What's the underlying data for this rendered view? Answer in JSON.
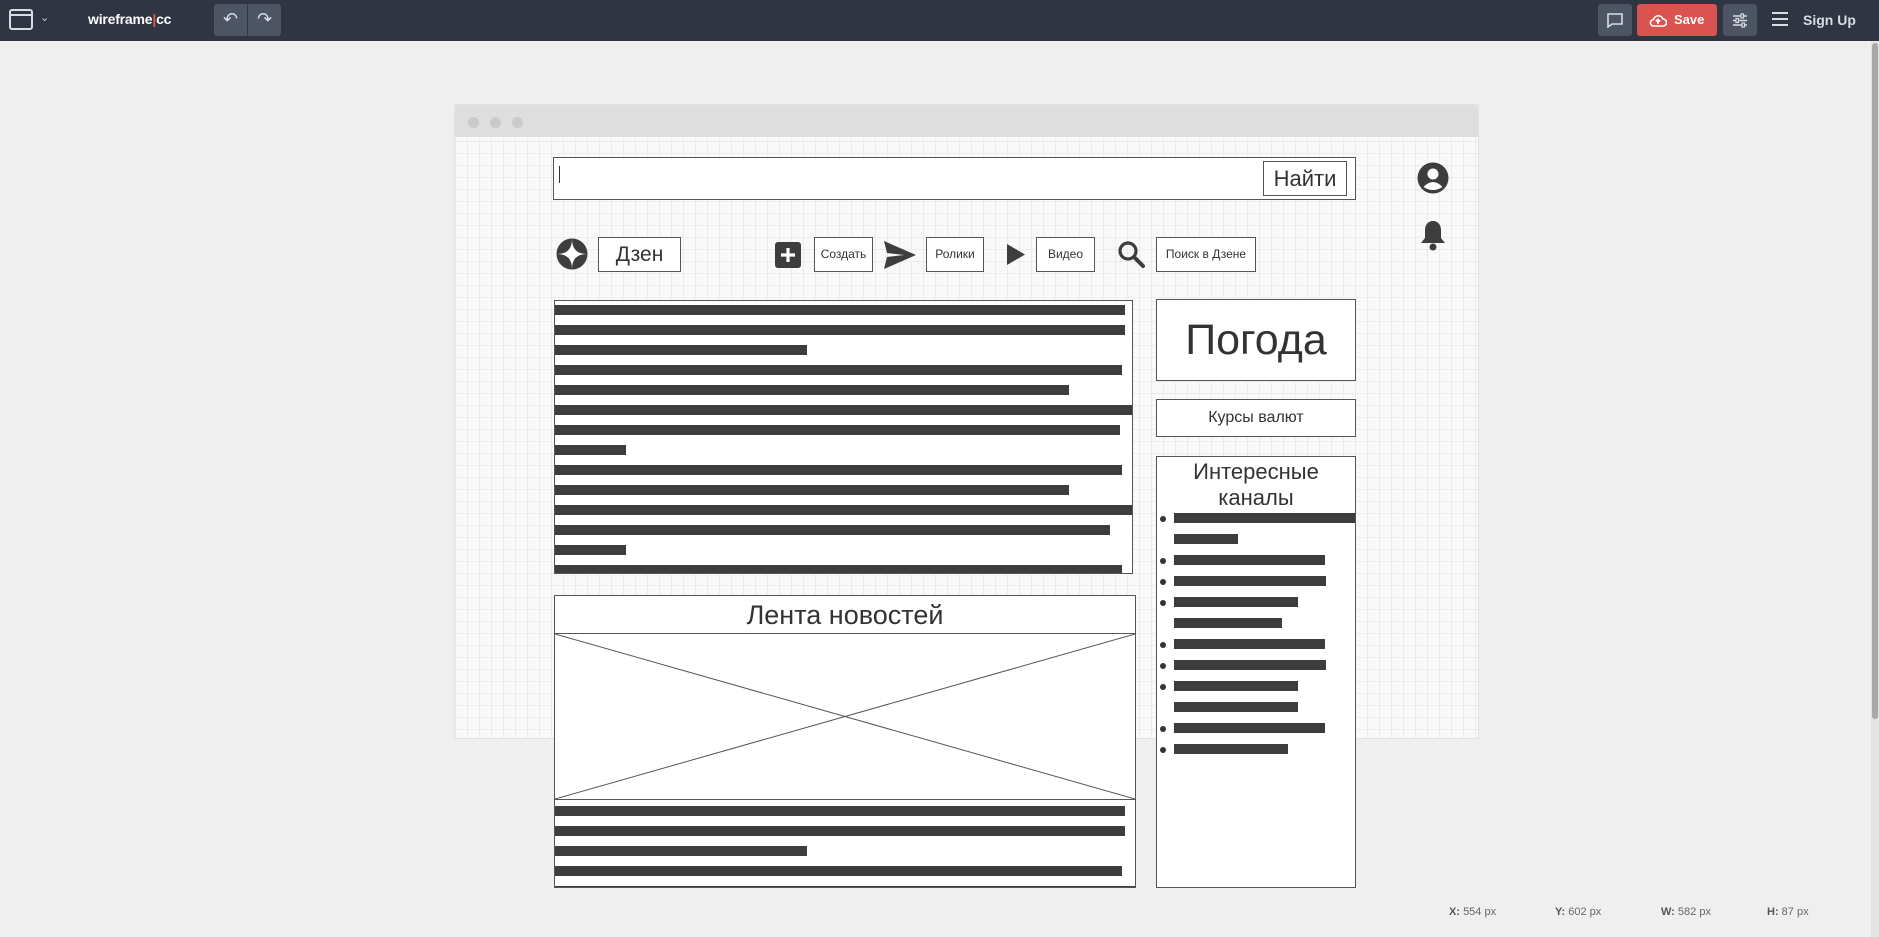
{
  "app": {
    "logo_left": "wireframe",
    "logo_sep": "|",
    "logo_right": "cc",
    "save_label": "Save",
    "signup_label": "Sign Up"
  },
  "mockup": {
    "search_button": "Найти",
    "nav": {
      "dzen": "Дзен",
      "create": "Создать",
      "reels": "Ролики",
      "video": "Видео",
      "search_in_dzen": "Поиск в Дзене"
    },
    "weather": "Погода",
    "currency": "Курсы валют",
    "channels_title_1": "Интересные",
    "channels_title_2": "каналы",
    "news_title": "Лента новостей"
  },
  "status": {
    "x_label": "X:",
    "x": "554 px",
    "y_label": "Y:",
    "y": "602 px",
    "w_label": "W:",
    "w": "582 px",
    "h_label": "H:",
    "h": "87 px"
  },
  "colors": {
    "topbar": "#2f3541",
    "save": "#d9534f",
    "accent_logo": "#e05a4f"
  }
}
